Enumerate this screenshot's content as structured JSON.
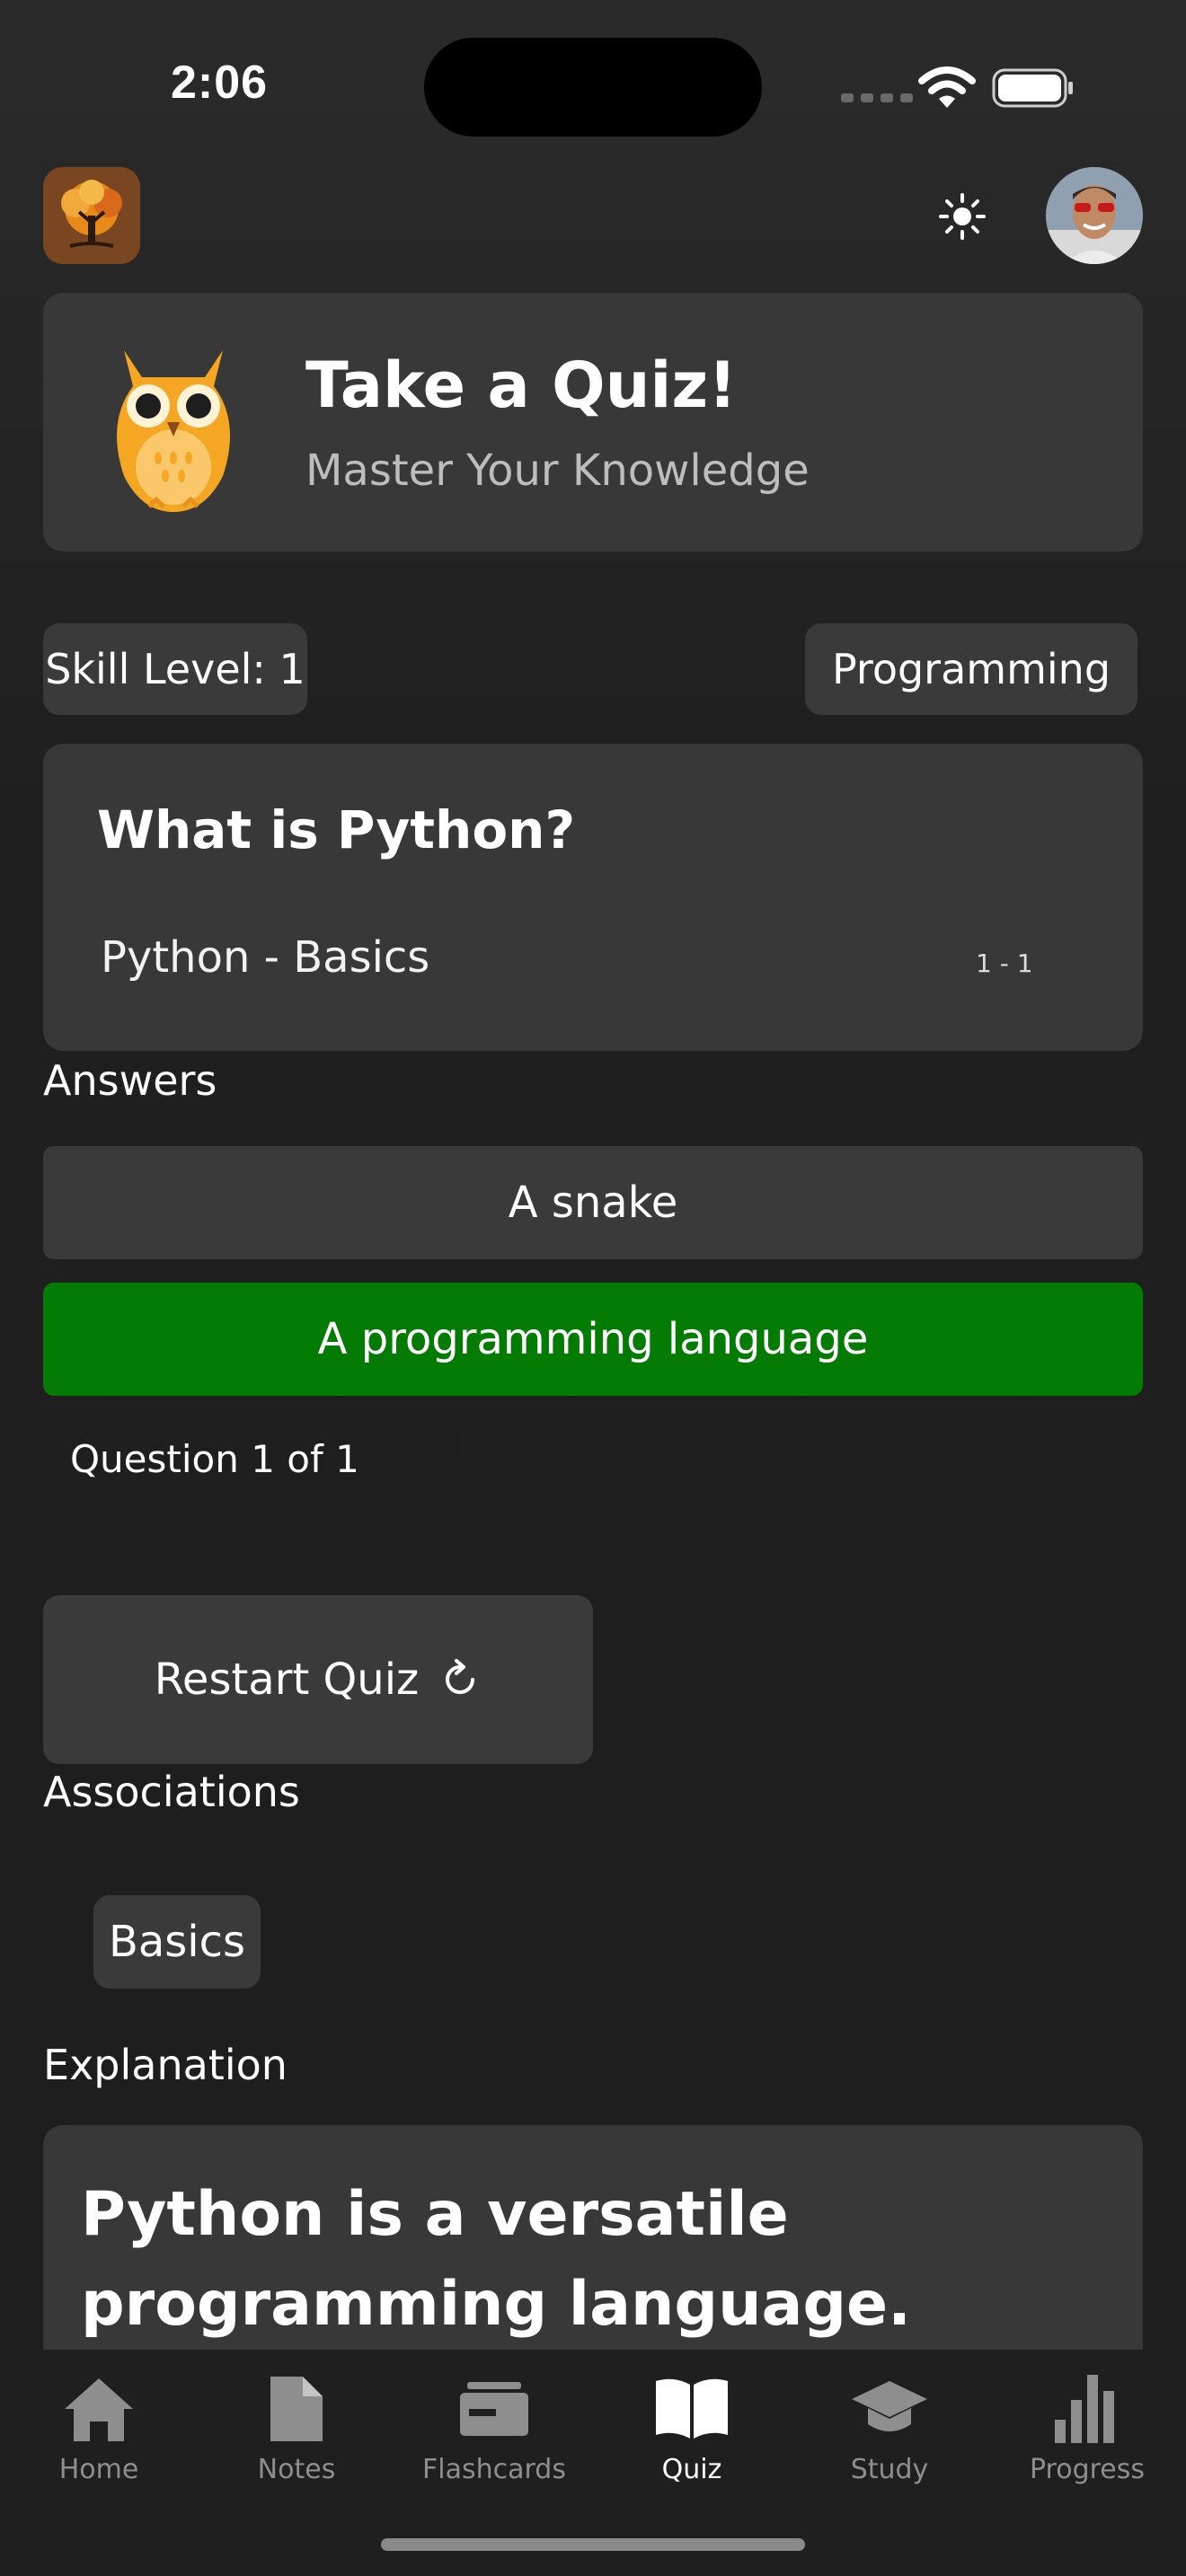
{
  "status_bar": {
    "time": "2:06"
  },
  "header": {
    "logo_icon": "tree-logo-icon",
    "theme_icon": "sun-icon",
    "avatar_icon": "user-avatar"
  },
  "hero": {
    "title": "Take a Quiz!",
    "subtitle": "Master Your Knowledge",
    "mascot_icon": "owl-icon"
  },
  "chips": {
    "skill_level": "Skill Level: 1",
    "category": "Programming"
  },
  "question": {
    "title": "What is Python?",
    "topic": "Python - Basics",
    "range": "1 - 1"
  },
  "answers": {
    "label": "Answers",
    "items": [
      {
        "text": "A snake",
        "state": "default"
      },
      {
        "text": "A programming language",
        "state": "correct",
        "color": "#047c04"
      }
    ]
  },
  "progress_text": "Question 1 of 1",
  "restart_label": "Restart Quiz",
  "associations": {
    "label": "Associations",
    "tags": [
      "Basics"
    ]
  },
  "explanation": {
    "label": "Explanation",
    "text": "Python is a versatile programming language."
  },
  "tabbar": {
    "tabs": [
      {
        "label": "Home",
        "icon": "home-icon"
      },
      {
        "label": "Notes",
        "icon": "note-icon"
      },
      {
        "label": "Flashcards",
        "icon": "cards-icon"
      },
      {
        "label": "Quiz",
        "icon": "book-icon",
        "active": true
      },
      {
        "label": "Study",
        "icon": "graduation-cap-icon"
      },
      {
        "label": "Progress",
        "icon": "bar-chart-icon"
      }
    ]
  },
  "colors": {
    "background": "#1f1f1f",
    "card": "#383838",
    "correct": "#047c04",
    "inactive_tab": "#8e8e8e"
  }
}
